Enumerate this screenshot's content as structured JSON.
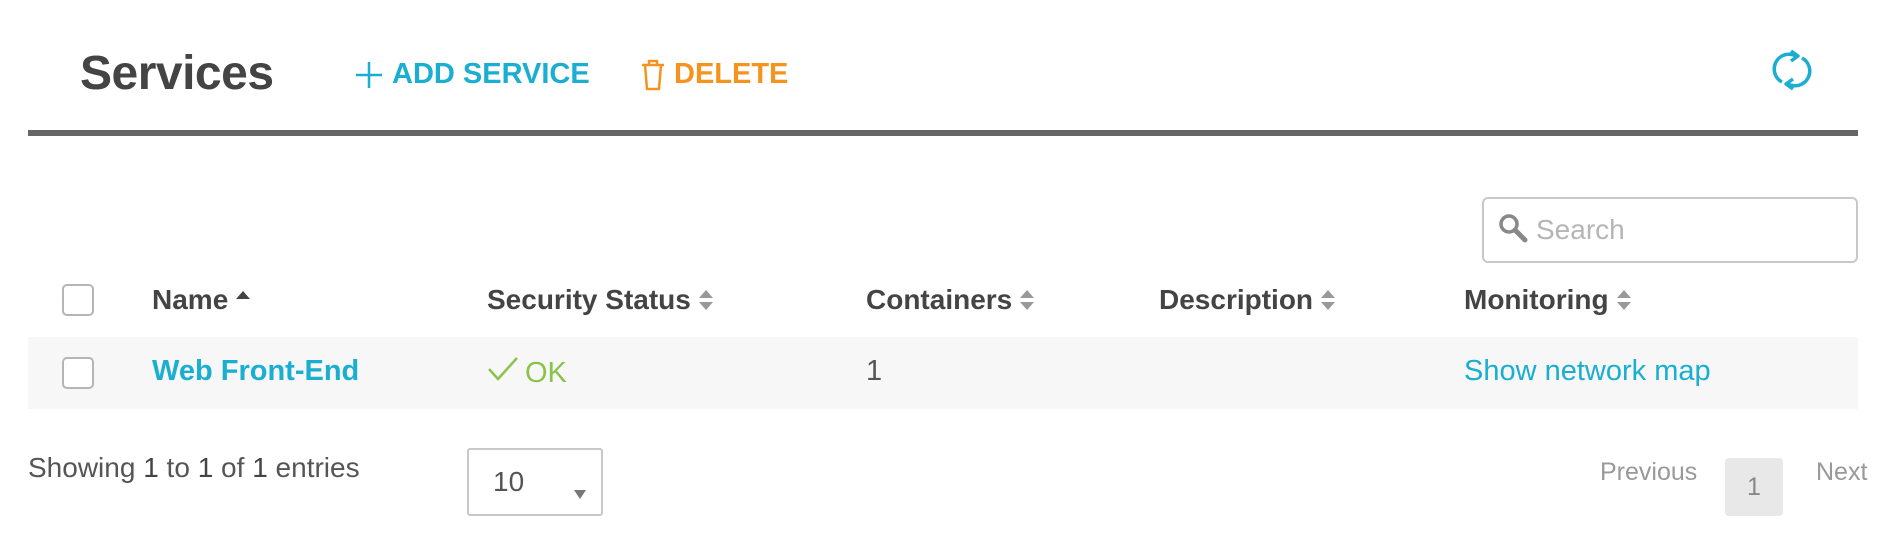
{
  "header": {
    "title": "Services",
    "add_label": "ADD SERVICE",
    "delete_label": "DELETE",
    "colors": {
      "accent": "#1aaed1",
      "delete": "#f5931e",
      "ok": "#8bc34a"
    }
  },
  "search": {
    "placeholder": "Search",
    "value": ""
  },
  "table": {
    "columns": [
      "Name",
      "Security Status",
      "Containers",
      "Description",
      "Monitoring"
    ],
    "sort": {
      "column": "Name",
      "direction": "asc"
    },
    "rows": [
      {
        "name": "Web Front-End",
        "status": "OK",
        "containers": "1",
        "description": "",
        "monitoring": "Show network map"
      }
    ]
  },
  "footer": {
    "info": {
      "prefix": "Showing",
      "from": "1",
      "to_word": "to",
      "to": "1",
      "of_word": "of",
      "total": "1",
      "suffix": "entries"
    },
    "page_length": "10",
    "pagination": {
      "previous": "Previous",
      "current": "1",
      "next": "Next"
    }
  }
}
